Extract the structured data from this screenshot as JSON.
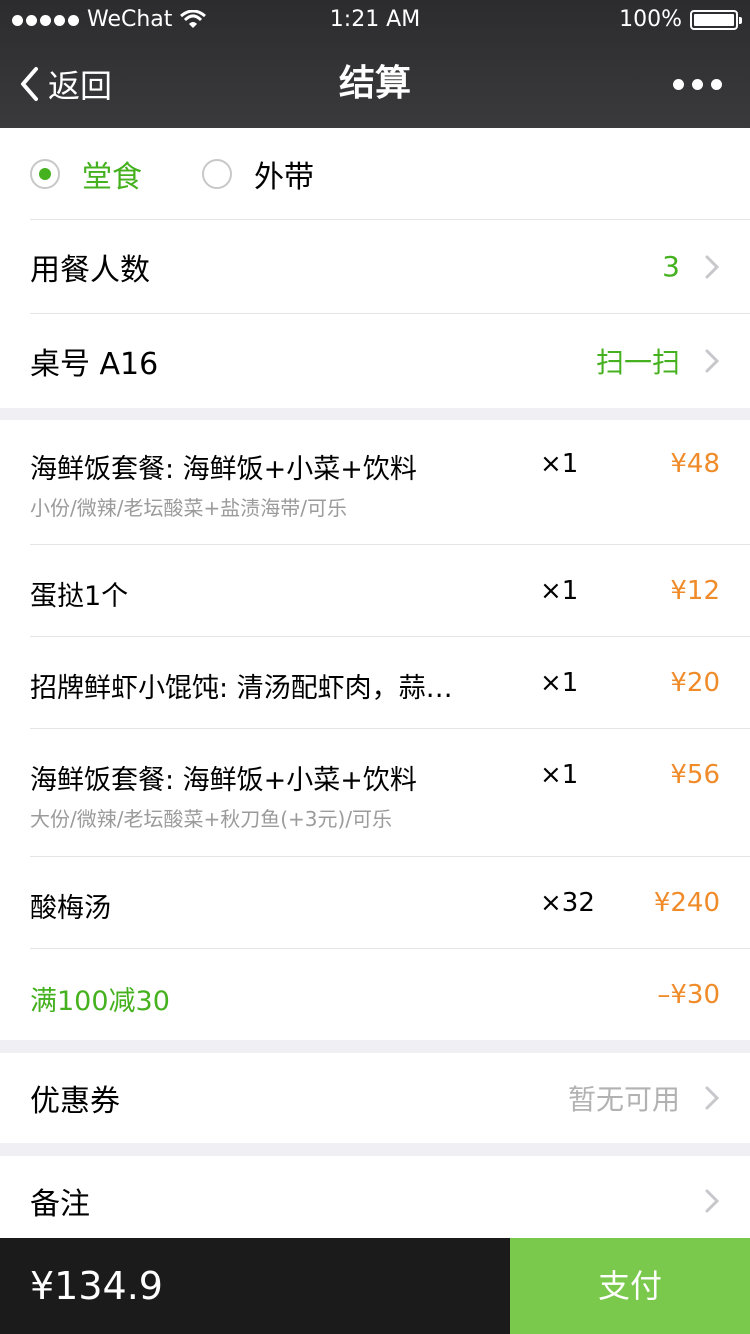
{
  "status": {
    "carrier": "WeChat",
    "time": "1:21 AM",
    "battery": "100%",
    "battery_level": 1.0
  },
  "nav": {
    "back_label": "返回",
    "title": "结算"
  },
  "dine_options": [
    {
      "label": "堂食",
      "selected": true
    },
    {
      "label": "外带",
      "selected": false
    }
  ],
  "guests": {
    "label": "用餐人数",
    "value": "3"
  },
  "table": {
    "label": "桌号 A16",
    "action": "扫一扫"
  },
  "order_items": [
    {
      "name": "海鲜饭套餐: 海鲜饭+小菜+饮料",
      "options": "小份/微辣/老坛酸菜+盐渍海带/可乐",
      "qty": "×1",
      "price": "¥48"
    },
    {
      "name": "蛋挞1个",
      "options": "",
      "qty": "×1",
      "price": "¥12"
    },
    {
      "name": "招牌鲜虾小馄饨: 清汤配虾肉，蒜…",
      "options": "",
      "qty": "×1",
      "price": "¥20"
    },
    {
      "name": "海鲜饭套餐: 海鲜饭+小菜+饮料",
      "options": "大份/微辣/老坛酸菜+秋刀鱼(+3元)/可乐",
      "qty": "×1",
      "price": "¥56"
    },
    {
      "name": "酸梅汤",
      "options": "",
      "qty": "×32",
      "price": "¥240"
    }
  ],
  "discount": {
    "label": "满100减30",
    "amount": "–¥30"
  },
  "coupon": {
    "label": "优惠券",
    "value": "暂无可用"
  },
  "remark": {
    "label": "备注"
  },
  "footer": {
    "total": "¥134.9",
    "pay_label": "支付"
  },
  "colors": {
    "accent_green": "#45b11f",
    "price_orange": "#f08b2a",
    "pay_button": "#7ac94c",
    "nav_bg": "#2c2c2e"
  }
}
